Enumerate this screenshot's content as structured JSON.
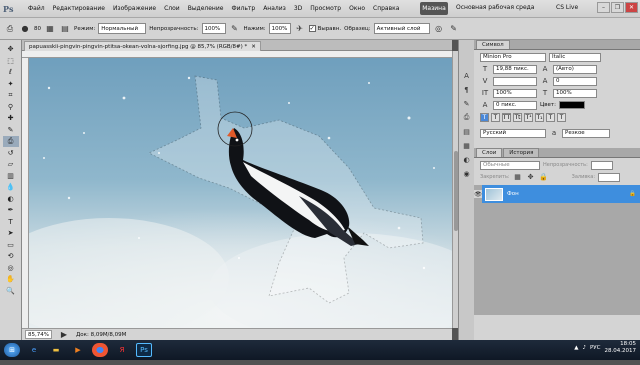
{
  "app": {
    "logo": "Ps",
    "menu": [
      "Файл",
      "Редактирование",
      "Изображение",
      "Слои",
      "Выделение",
      "Фильтр",
      "Анализ",
      "3D",
      "Просмотр",
      "Окно",
      "Справка"
    ],
    "workspace_button": "Мазина",
    "workspace_label": "Основная рабочая среда",
    "cs_live": "CS Live"
  },
  "options": {
    "size": "80",
    "mode_label": "Режим:",
    "mode_value": "Нормальный",
    "opacity_label": "Непрозрачность:",
    "opacity_value": "100%",
    "pressure_label": "Нажим:",
    "pressure_value": "100%",
    "align_label": "Выравн.",
    "sample_label": "Образец:",
    "sample_value": "Активный слой"
  },
  "document": {
    "tab_title": "papuasskii-pingvin-pingvin-ptitsa-okean-volna-sjorfing.jpg @ 85,7% (RGB/8#) *",
    "zoom": "85,74%",
    "doc_info": "Док: 8,09М/8,09М"
  },
  "character_panel": {
    "tab": "Символ",
    "font_family": "Minion Pro",
    "font_style": "Italic",
    "font_size": "19,88 пикс.",
    "leading": "(Авто)",
    "kerning": "",
    "tracking": "0",
    "vscale": "100%",
    "hscale": "100%",
    "baseline": "0 пикс.",
    "color_label": "Цвет:",
    "language": "Русский",
    "antialias": "Резкое"
  },
  "layers_panel": {
    "tabs": [
      "Слои",
      "История"
    ],
    "blend_mode": "Обычные",
    "opacity_label": "Непрозрачность:",
    "lock_label": "Закрепить:",
    "fill_label": "Заливка:",
    "layer_name": "Фон"
  },
  "taskbar": {
    "lang": "РУС",
    "time": "18:05",
    "date": "28.04.2017"
  }
}
